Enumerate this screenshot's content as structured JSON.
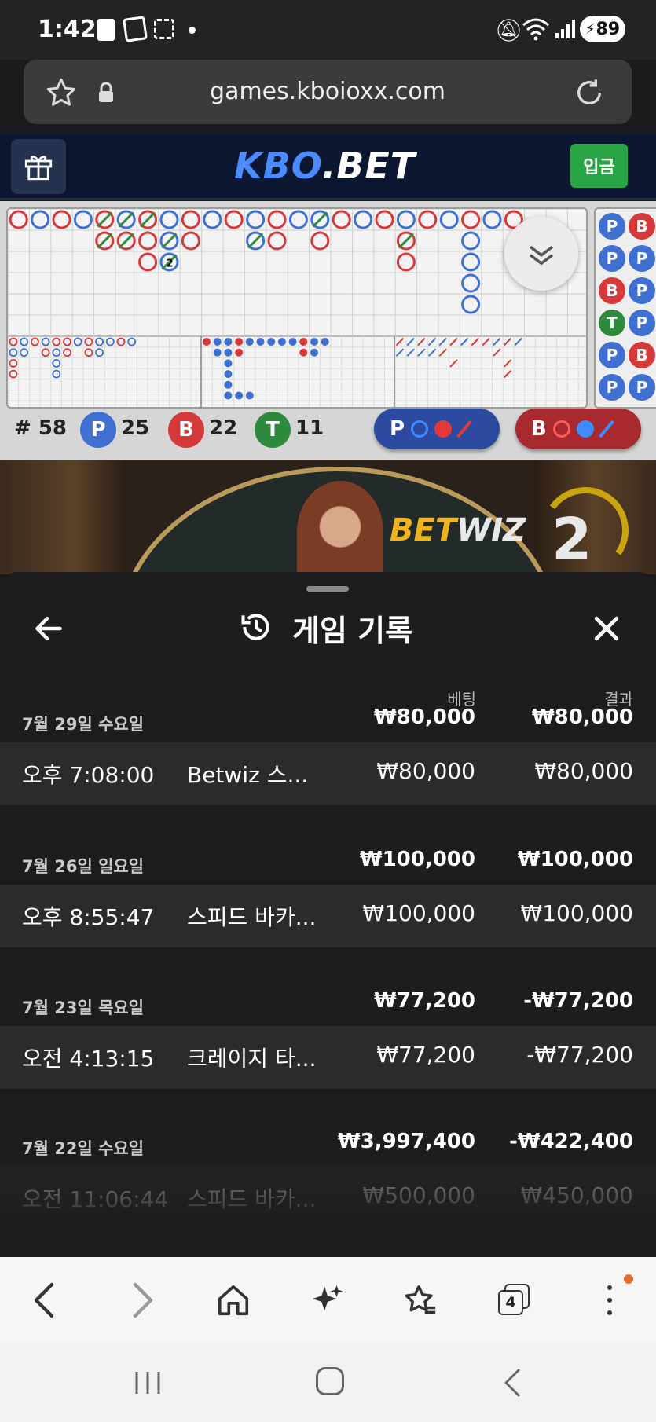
{
  "status_bar": {
    "time": "1:42",
    "battery": "89"
  },
  "url_bar": {
    "url": "games.kboioxx.com"
  },
  "site_header": {
    "logo_kbo": "KBO",
    "logo_bet": ".BET",
    "deposit_label": "입금"
  },
  "roadmap": {
    "shoe_count_label": "# 58",
    "player": {
      "letter": "P",
      "count": "25"
    },
    "banker": {
      "letter": "B",
      "count": "22"
    },
    "tie": {
      "letter": "T",
      "count": "11"
    },
    "predict_player": "P",
    "predict_banker": "B",
    "sidebar_beads": [
      "P",
      "B",
      "P",
      "P",
      "B",
      "P",
      "T",
      "P",
      "P",
      "B",
      "P",
      "P"
    ],
    "mark_number": "2",
    "colors": {
      "player": "#3f6fd1",
      "banker": "#d6393a",
      "tie": "#2e8a3c"
    }
  },
  "video": {
    "brand_bet": "BET",
    "brand_wiz": "WIZ",
    "round_number": "2"
  },
  "sheet": {
    "title": "게임 기록",
    "col_bet": "베팅",
    "col_result": "결과",
    "groups": [
      {
        "date": "7월 29일 수요일",
        "bet_total": "₩80,000",
        "result_total": "₩80,000",
        "item": {
          "time": "오후 7:08:00",
          "game": "Betwiz 스...",
          "bet": "₩80,000",
          "result": "₩80,000"
        }
      },
      {
        "date": "7월 26일 일요일",
        "bet_total": "₩100,000",
        "result_total": "₩100,000",
        "item": {
          "time": "오후 8:55:47",
          "game": "스피드 바카...",
          "bet": "₩100,000",
          "result": "₩100,000"
        }
      },
      {
        "date": "7월 23일 목요일",
        "bet_total": "₩77,200",
        "result_total": "-₩77,200",
        "item": {
          "time": "오전 4:13:15",
          "game": "크레이지 타...",
          "bet": "₩77,200",
          "result": "-₩77,200"
        }
      },
      {
        "date": "7월 22일 수요일",
        "bet_total": "₩3,997,400",
        "result_total": "-₩422,400",
        "item": {
          "time": "오전 11:06:44",
          "game": "스피드 바카...",
          "bet": "₩500,000",
          "result": "₩450,000"
        }
      }
    ]
  },
  "browser_toolbar": {
    "tabs_count": "4"
  }
}
